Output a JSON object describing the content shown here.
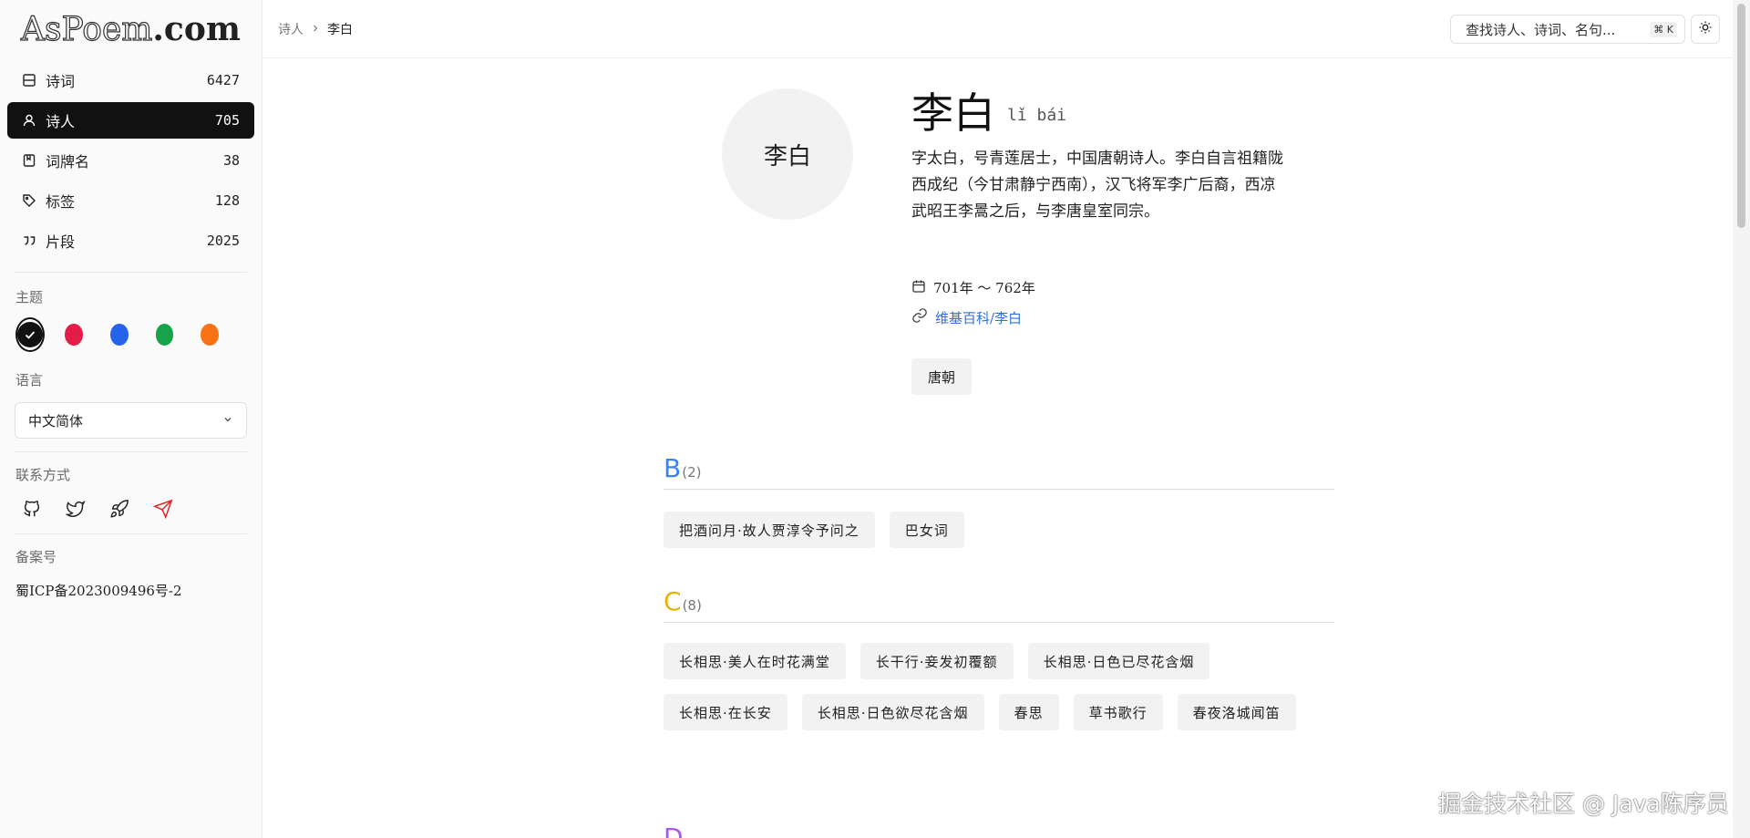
{
  "logo": {
    "outline_part": "AsPoem",
    "bold_part": ".com"
  },
  "nav": [
    {
      "label": "诗词",
      "count": "6427",
      "icon": "book-icon",
      "active": false
    },
    {
      "label": "诗人",
      "count": "705",
      "icon": "user-icon",
      "active": true
    },
    {
      "label": "词牌名",
      "count": "38",
      "icon": "bookmark-book-icon",
      "active": false
    },
    {
      "label": "标签",
      "count": "128",
      "icon": "tag-icon",
      "active": false
    },
    {
      "label": "片段",
      "count": "2025",
      "icon": "quote-icon",
      "active": false
    }
  ],
  "sidebar": {
    "theme_title": "主题",
    "theme_colors": [
      "#111111",
      "#e11d48",
      "#2563eb",
      "#16a34a",
      "#f97316"
    ],
    "language_title": "语言",
    "language_value": "中文简体",
    "contact_title": "联系方式",
    "contacts": [
      "github-icon",
      "twitter-icon",
      "rocket-icon",
      "send-icon"
    ],
    "icp_title": "备案号",
    "icp_value": "蜀ICP备2023009496号-2"
  },
  "topbar": {
    "breadcrumb_parent": "诗人",
    "breadcrumb_current": "李白",
    "search_placeholder": "查找诗人、诗词、名句...",
    "shortcut": "⌘ K"
  },
  "poet": {
    "avatar_text": "李白",
    "name": "李白",
    "pinyin": "lǐ bái",
    "bio": "字太白，号青莲居士，中国唐朝诗人。李白自言祖籍陇西成纪（今甘肃静宁西南），汉飞将军李广后裔，西凉武昭王李暠之后，与李唐皇室同宗。",
    "dates": "701年 ～ 762年",
    "link_text": "维基百科/李白",
    "dynasty_tag": "唐朝"
  },
  "sections": [
    {
      "letter": "B",
      "count": "(2)",
      "color": "#3b82f6",
      "items": [
        "把酒问月·故人贾淳令予问之",
        "巴女词"
      ]
    },
    {
      "letter": "C",
      "count": "(8)",
      "color": "#eab308",
      "items": [
        "长相思·美人在时花满堂",
        "长干行·妾发初覆额",
        "长相思·日色已尽花含烟",
        "长相思·在长安",
        "长相思·日色欲尽花含烟",
        "春思",
        "草书歌行",
        "春夜洛城闻笛"
      ]
    }
  ],
  "watermark": "掘金技术社区 @ Java陈序员"
}
